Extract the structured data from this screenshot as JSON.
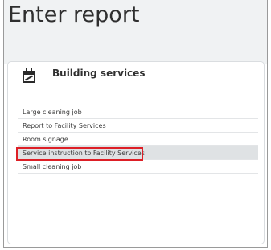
{
  "page": {
    "title": "Enter report"
  },
  "card": {
    "title": "Building services",
    "icon": "calendar-icon",
    "items": [
      {
        "label": "Large cleaning job",
        "selected": false
      },
      {
        "label": "Report to Facility Services",
        "selected": false
      },
      {
        "label": "Room signage",
        "selected": false
      },
      {
        "label": "Service instruction to Facility Services",
        "selected": true
      },
      {
        "label": "Small cleaning job",
        "selected": false
      }
    ]
  },
  "colors": {
    "selected_row": "#dfe2e4",
    "highlight_border": "#dd1f26",
    "header_background": "#f0f2f3"
  }
}
